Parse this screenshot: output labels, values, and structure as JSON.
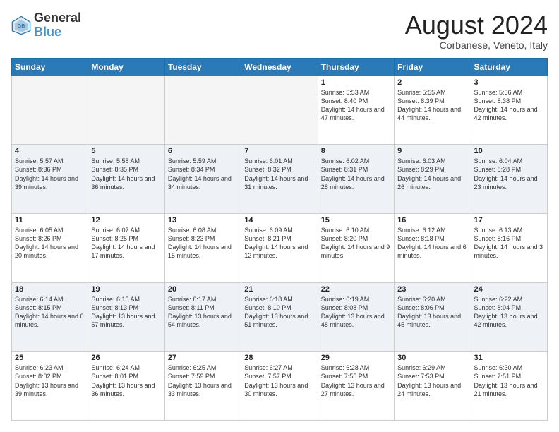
{
  "logo": {
    "line1": "General",
    "line2": "Blue"
  },
  "title": "August 2024",
  "subtitle": "Corbanese, Veneto, Italy",
  "weekdays": [
    "Sunday",
    "Monday",
    "Tuesday",
    "Wednesday",
    "Thursday",
    "Friday",
    "Saturday"
  ],
  "weeks": [
    [
      {
        "day": "",
        "info": ""
      },
      {
        "day": "",
        "info": ""
      },
      {
        "day": "",
        "info": ""
      },
      {
        "day": "",
        "info": ""
      },
      {
        "day": "1",
        "info": "Sunrise: 5:53 AM\nSunset: 8:40 PM\nDaylight: 14 hours and 47 minutes."
      },
      {
        "day": "2",
        "info": "Sunrise: 5:55 AM\nSunset: 8:39 PM\nDaylight: 14 hours and 44 minutes."
      },
      {
        "day": "3",
        "info": "Sunrise: 5:56 AM\nSunset: 8:38 PM\nDaylight: 14 hours and 42 minutes."
      }
    ],
    [
      {
        "day": "4",
        "info": "Sunrise: 5:57 AM\nSunset: 8:36 PM\nDaylight: 14 hours and 39 minutes."
      },
      {
        "day": "5",
        "info": "Sunrise: 5:58 AM\nSunset: 8:35 PM\nDaylight: 14 hours and 36 minutes."
      },
      {
        "day": "6",
        "info": "Sunrise: 5:59 AM\nSunset: 8:34 PM\nDaylight: 14 hours and 34 minutes."
      },
      {
        "day": "7",
        "info": "Sunrise: 6:01 AM\nSunset: 8:32 PM\nDaylight: 14 hours and 31 minutes."
      },
      {
        "day": "8",
        "info": "Sunrise: 6:02 AM\nSunset: 8:31 PM\nDaylight: 14 hours and 28 minutes."
      },
      {
        "day": "9",
        "info": "Sunrise: 6:03 AM\nSunset: 8:29 PM\nDaylight: 14 hours and 26 minutes."
      },
      {
        "day": "10",
        "info": "Sunrise: 6:04 AM\nSunset: 8:28 PM\nDaylight: 14 hours and 23 minutes."
      }
    ],
    [
      {
        "day": "11",
        "info": "Sunrise: 6:05 AM\nSunset: 8:26 PM\nDaylight: 14 hours and 20 minutes."
      },
      {
        "day": "12",
        "info": "Sunrise: 6:07 AM\nSunset: 8:25 PM\nDaylight: 14 hours and 17 minutes."
      },
      {
        "day": "13",
        "info": "Sunrise: 6:08 AM\nSunset: 8:23 PM\nDaylight: 14 hours and 15 minutes."
      },
      {
        "day": "14",
        "info": "Sunrise: 6:09 AM\nSunset: 8:21 PM\nDaylight: 14 hours and 12 minutes."
      },
      {
        "day": "15",
        "info": "Sunrise: 6:10 AM\nSunset: 8:20 PM\nDaylight: 14 hours and 9 minutes."
      },
      {
        "day": "16",
        "info": "Sunrise: 6:12 AM\nSunset: 8:18 PM\nDaylight: 14 hours and 6 minutes."
      },
      {
        "day": "17",
        "info": "Sunrise: 6:13 AM\nSunset: 8:16 PM\nDaylight: 14 hours and 3 minutes."
      }
    ],
    [
      {
        "day": "18",
        "info": "Sunrise: 6:14 AM\nSunset: 8:15 PM\nDaylight: 14 hours and 0 minutes."
      },
      {
        "day": "19",
        "info": "Sunrise: 6:15 AM\nSunset: 8:13 PM\nDaylight: 13 hours and 57 minutes."
      },
      {
        "day": "20",
        "info": "Sunrise: 6:17 AM\nSunset: 8:11 PM\nDaylight: 13 hours and 54 minutes."
      },
      {
        "day": "21",
        "info": "Sunrise: 6:18 AM\nSunset: 8:10 PM\nDaylight: 13 hours and 51 minutes."
      },
      {
        "day": "22",
        "info": "Sunrise: 6:19 AM\nSunset: 8:08 PM\nDaylight: 13 hours and 48 minutes."
      },
      {
        "day": "23",
        "info": "Sunrise: 6:20 AM\nSunset: 8:06 PM\nDaylight: 13 hours and 45 minutes."
      },
      {
        "day": "24",
        "info": "Sunrise: 6:22 AM\nSunset: 8:04 PM\nDaylight: 13 hours and 42 minutes."
      }
    ],
    [
      {
        "day": "25",
        "info": "Sunrise: 6:23 AM\nSunset: 8:02 PM\nDaylight: 13 hours and 39 minutes."
      },
      {
        "day": "26",
        "info": "Sunrise: 6:24 AM\nSunset: 8:01 PM\nDaylight: 13 hours and 36 minutes."
      },
      {
        "day": "27",
        "info": "Sunrise: 6:25 AM\nSunset: 7:59 PM\nDaylight: 13 hours and 33 minutes."
      },
      {
        "day": "28",
        "info": "Sunrise: 6:27 AM\nSunset: 7:57 PM\nDaylight: 13 hours and 30 minutes."
      },
      {
        "day": "29",
        "info": "Sunrise: 6:28 AM\nSunset: 7:55 PM\nDaylight: 13 hours and 27 minutes."
      },
      {
        "day": "30",
        "info": "Sunrise: 6:29 AM\nSunset: 7:53 PM\nDaylight: 13 hours and 24 minutes."
      },
      {
        "day": "31",
        "info": "Sunrise: 6:30 AM\nSunset: 7:51 PM\nDaylight: 13 hours and 21 minutes."
      }
    ]
  ]
}
